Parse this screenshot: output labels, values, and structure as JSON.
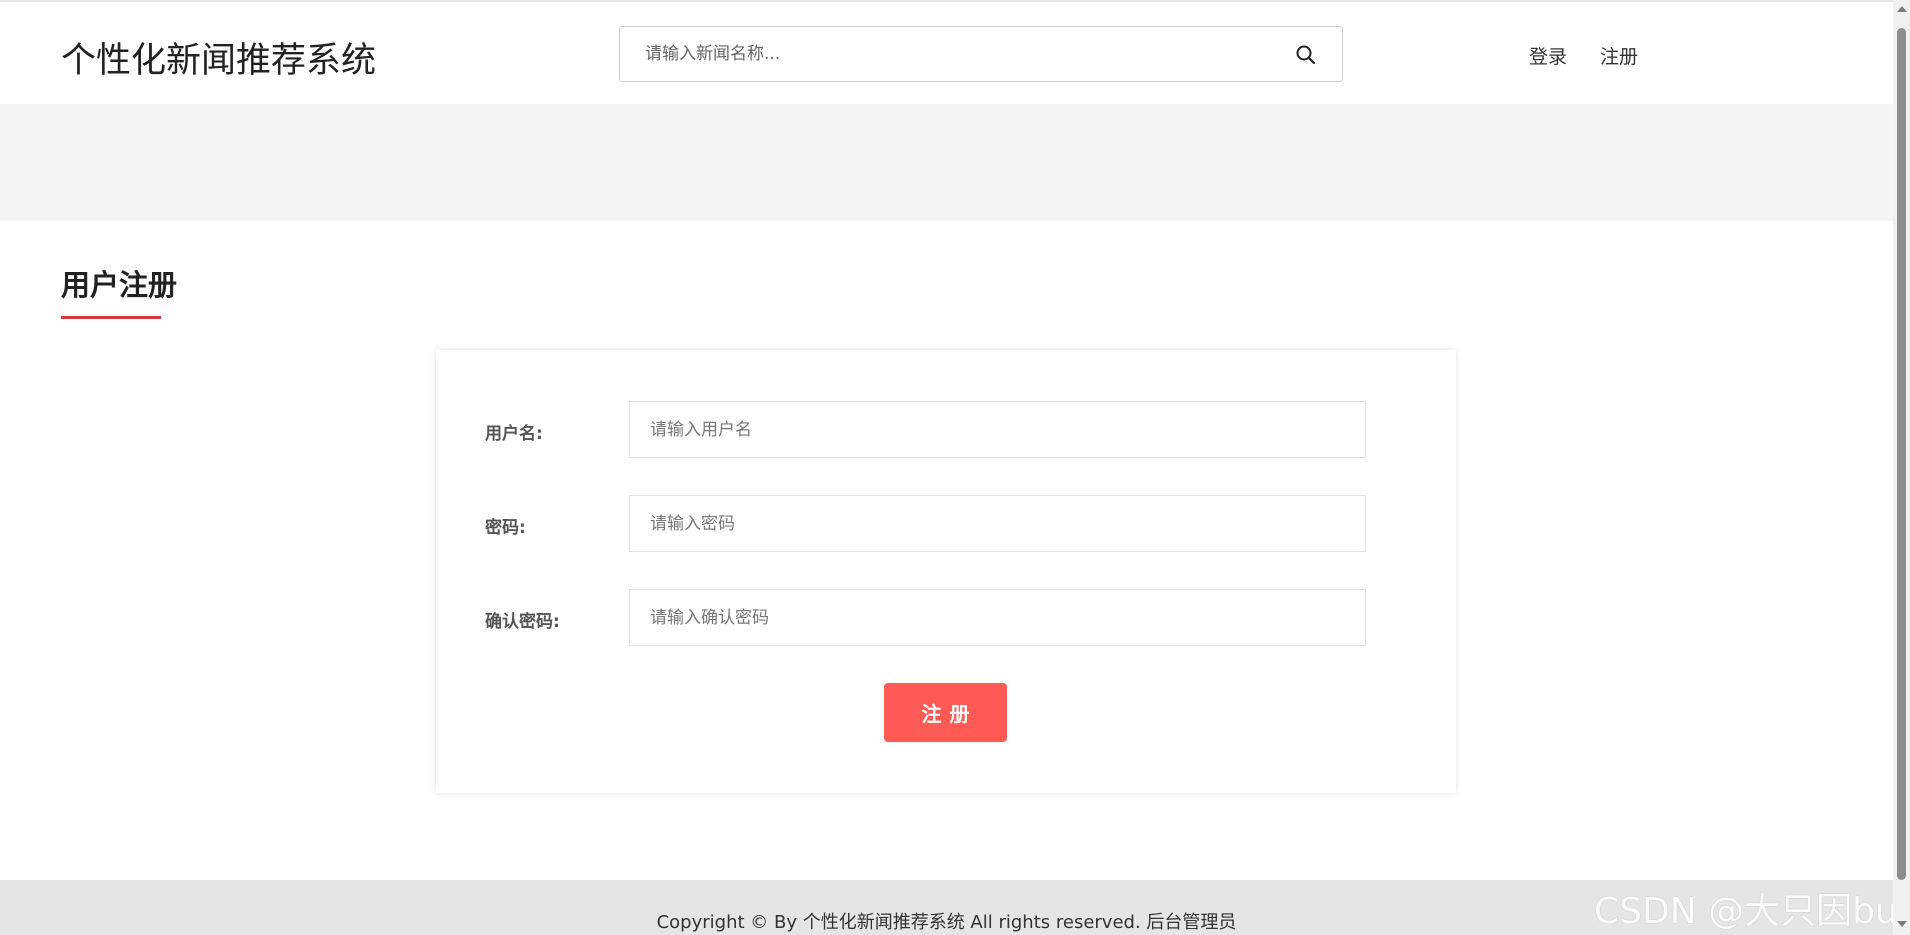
{
  "header": {
    "logo": "个性化新闻推荐系统",
    "search": {
      "placeholder": "请输入新闻名称...",
      "value": "",
      "icon": "search-icon"
    },
    "nav": {
      "login": "登录",
      "register": "注册"
    }
  },
  "section": {
    "title": "用户注册"
  },
  "form": {
    "username": {
      "label": "用户名:",
      "placeholder": "请输入用户名",
      "value": ""
    },
    "password": {
      "label": "密码:",
      "placeholder": "请输入密码",
      "value": ""
    },
    "confirm": {
      "label": "确认密码:",
      "placeholder": "请输入确认密码",
      "value": ""
    },
    "submit_label": "注册"
  },
  "footer": {
    "copyright": "Copyright © By 个性化新闻推荐系统 All rights reserved. 后台管理员"
  },
  "watermark": "CSDN @大只因bug",
  "colors": {
    "accent": "#d9363e",
    "button": "#ff5a56",
    "banner": "#f5f5f5",
    "footer": "#e5e5e5"
  }
}
